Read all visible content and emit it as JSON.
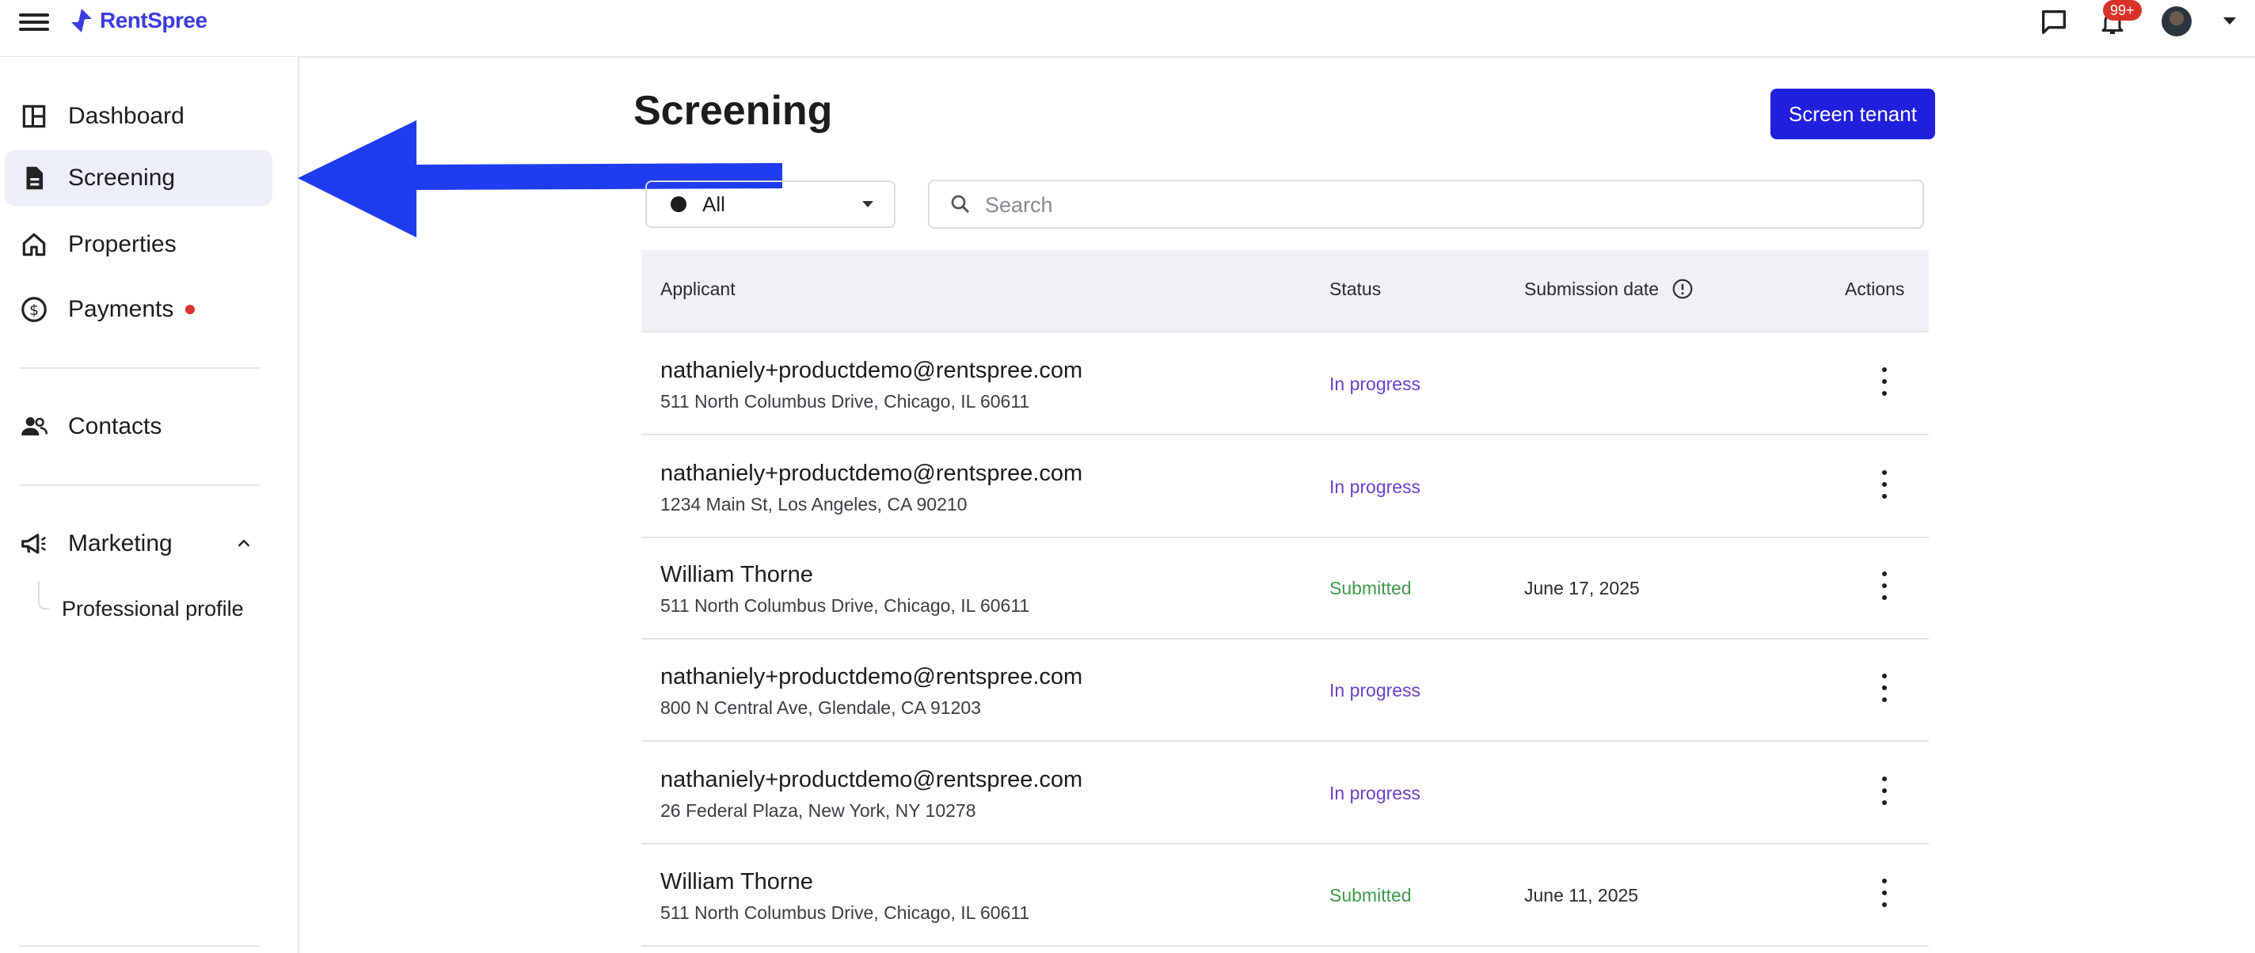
{
  "app": {
    "name": "RentSpree"
  },
  "header": {
    "notifications_badge": "99+"
  },
  "sidebar": {
    "items": [
      {
        "label": "Dashboard",
        "icon": "dashboard-icon"
      },
      {
        "label": "Screening",
        "icon": "document-icon",
        "active": true
      },
      {
        "label": "Properties",
        "icon": "home-icon"
      },
      {
        "label": "Payments",
        "icon": "dollar-icon",
        "has_alert_dot": true
      },
      {
        "label": "Contacts",
        "icon": "people-icon"
      },
      {
        "label": "Marketing",
        "icon": "megaphone-icon",
        "expanded": true
      },
      {
        "label": "Professional profile",
        "sub_item": true
      }
    ]
  },
  "page": {
    "title": "Screening",
    "primary_button": "Screen tenant",
    "filter": {
      "selected": "All"
    },
    "search": {
      "placeholder": "Search",
      "value": ""
    }
  },
  "table": {
    "columns": [
      "Applicant",
      "Status",
      "Submission date",
      "Actions"
    ],
    "rows": [
      {
        "applicant": "nathaniely+productdemo@rentspree.com",
        "address": "511 North Columbus Drive, Chicago, IL 60611",
        "status": "In progress",
        "date": ""
      },
      {
        "applicant": "nathaniely+productdemo@rentspree.com",
        "address": "1234 Main St, Los Angeles, CA 90210",
        "status": "In progress",
        "date": ""
      },
      {
        "applicant": "William Thorne",
        "address": "511 North Columbus Drive, Chicago, IL 60611",
        "status": "Submitted",
        "date": "June 17, 2025"
      },
      {
        "applicant": "nathaniely+productdemo@rentspree.com",
        "address": "800 N Central Ave, Glendale, CA 91203",
        "status": "In progress",
        "date": ""
      },
      {
        "applicant": "nathaniely+productdemo@rentspree.com",
        "address": "26 Federal Plaza, New York, NY 10278",
        "status": "In progress",
        "date": ""
      },
      {
        "applicant": "William Thorne",
        "address": "511 North Columbus Drive, Chicago, IL 60611",
        "status": "Submitted",
        "date": "June 11, 2025"
      }
    ]
  },
  "colors": {
    "brand": "#3b3be0",
    "primary_button": "#1f1fdc",
    "status_in_progress": "#6a3fc9",
    "status_submitted": "#3f9a4a",
    "annotation_arrow": "#1f3cf0",
    "alert_dot": "#d9322a"
  }
}
